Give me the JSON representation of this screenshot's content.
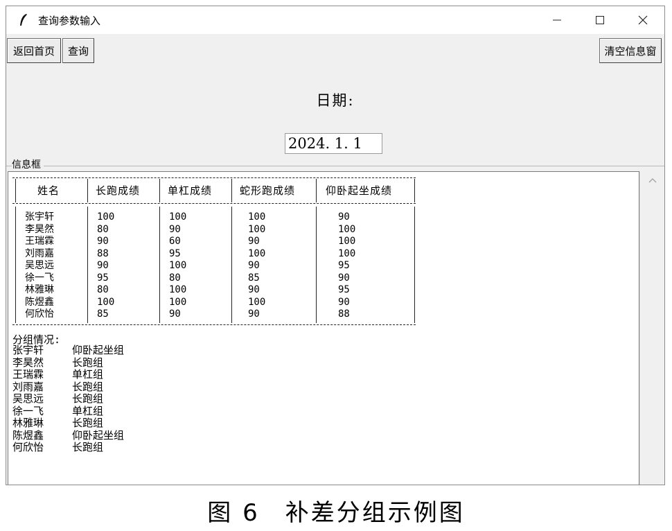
{
  "window": {
    "title": "查询参数输入",
    "controls": {
      "minimize": "—",
      "maximize": "☐",
      "close": "✕"
    }
  },
  "toolbar": {
    "back_label": "返回首页",
    "query_label": "查询",
    "clear_label": "清空信息窗"
  },
  "date": {
    "label": "日期:",
    "value": "2024. 1. 1"
  },
  "info_frame": {
    "label": "信息框",
    "table": {
      "headers": [
        "姓名",
        "长跑成绩",
        "单杠成绩",
        "蛇形跑成绩",
        "仰卧起坐成绩"
      ],
      "rows": [
        [
          "张宇轩",
          "100",
          "100",
          "100",
          "90"
        ],
        [
          "李昊然",
          "80",
          "90",
          "100",
          "100"
        ],
        [
          "王瑞霖",
          "90",
          "60",
          "90",
          "100"
        ],
        [
          "刘雨嘉",
          "88",
          "95",
          "100",
          "100"
        ],
        [
          "吴思远",
          "90",
          "100",
          "90",
          "95"
        ],
        [
          "徐一飞",
          "95",
          "80",
          "85",
          "90"
        ],
        [
          "林雅琳",
          "80",
          "100",
          "90",
          "95"
        ],
        [
          "陈煜鑫",
          "100",
          "100",
          "100",
          "90"
        ],
        [
          "何欣怡",
          "85",
          "90",
          "90",
          "88"
        ]
      ]
    },
    "grouping": {
      "title": "分组情况:",
      "items": [
        {
          "name": "张宇轩",
          "group": "仰卧起坐组"
        },
        {
          "name": "李昊然",
          "group": "长跑组"
        },
        {
          "name": "王瑞霖",
          "group": "单杠组"
        },
        {
          "name": "刘雨嘉",
          "group": "长跑组"
        },
        {
          "name": "吴思远",
          "group": "长跑组"
        },
        {
          "name": "徐一飞",
          "group": "单杠组"
        },
        {
          "name": "林雅琳",
          "group": "长跑组"
        },
        {
          "name": "陈煜鑫",
          "group": "仰卧起坐组"
        },
        {
          "name": "何欣怡",
          "group": "长跑组"
        }
      ]
    }
  },
  "caption": "图 6　补差分组示例图",
  "colors": {
    "window_bg": "#f0f0f0",
    "titlebar_bg": "#ffffff",
    "text": "#000000"
  },
  "icons": {
    "app": "feather-icon",
    "scroll_up": "chevron-up-icon"
  }
}
